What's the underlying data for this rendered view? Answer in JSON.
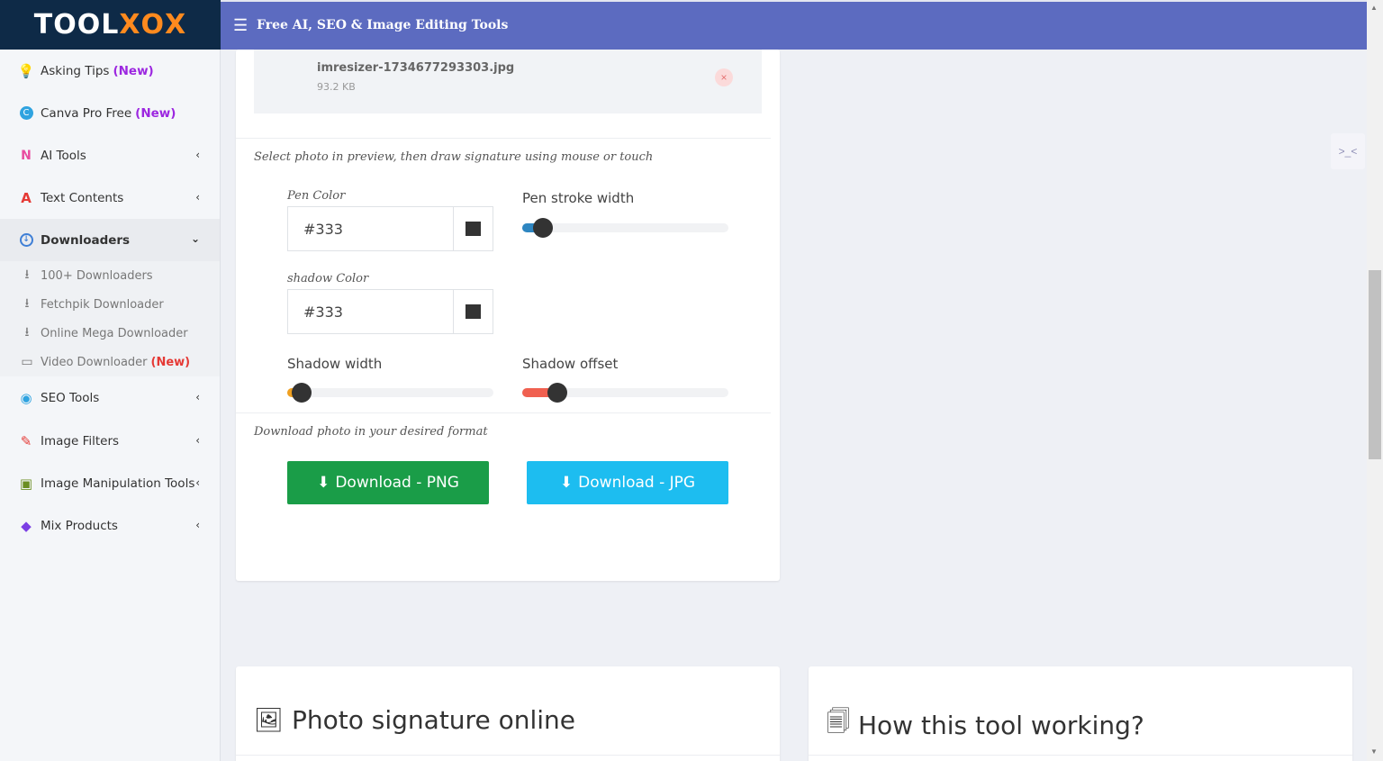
{
  "header": {
    "logo_part1": "TOOL",
    "logo_part2": "X",
    "logo_part3": "O",
    "logo_part4": "X",
    "title": "Free AI, SEO & Image Editing Tools",
    "menu_icon": "hamburger-icon"
  },
  "sidebar": {
    "items": [
      {
        "label": "Asking Tips",
        "badge": "(New)",
        "icon": "lightbulb-icon"
      },
      {
        "label": "Canva Pro Free",
        "badge": "(New)",
        "icon": "canva-icon"
      },
      {
        "label": "AI Tools",
        "icon": "ai-icon"
      },
      {
        "label": "Text Contents",
        "icon": "text-icon"
      },
      {
        "label": "Downloaders",
        "icon": "download-circle-icon"
      },
      {
        "label": "SEO Tools",
        "icon": "seo-icon"
      },
      {
        "label": "Image Filters",
        "icon": "brush-icon"
      },
      {
        "label": "Image Manipulation Tools",
        "icon": "image-icon"
      },
      {
        "label": "Mix Products",
        "icon": "layers-icon"
      }
    ],
    "sub_items": [
      {
        "label": "100+ Downloaders"
      },
      {
        "label": "Fetchpik Downloader"
      },
      {
        "label": "Online Mega Downloader"
      },
      {
        "label": "Video Downloader",
        "badge": "(New)"
      }
    ]
  },
  "file": {
    "name": "imresizer-1734677293303.jpg",
    "size": "93.2 KB",
    "remove_symbol": "×"
  },
  "editor": {
    "hint": "Select photo in preview, then draw signature using mouse or touch",
    "pen_color_label": "Pen Color",
    "pen_color_value": "#333",
    "pen_stroke_label": "Pen stroke width",
    "pen_stroke_level": 0.1,
    "shadow_color_label": "shadow Color",
    "shadow_color_value": "#333",
    "shadow_width_label": "Shadow width",
    "shadow_width_level": 0.07,
    "shadow_offset_label": "Shadow offset",
    "shadow_offset_level": 0.17,
    "download_hint": "Download photo in your desired format",
    "download_png": "Download - PNG",
    "download_jpg": "Download - JPG"
  },
  "sections": {
    "left_title": "Photo signature online",
    "right_title": "How this tool working?"
  },
  "colors": {
    "header_bg": "#5c6bc0",
    "logo_bg": "#0e2a47",
    "logo_accent": "#ff8a1e",
    "png_button": "#1a9d48",
    "jpg_button": "#1dbdf0",
    "pen_slider_fill": "#2e86c1",
    "shadow_width_fill": "#f0a020",
    "shadow_offset_fill": "#f06050",
    "new_badge": "#9c27e0",
    "new_badge_red": "#e53935"
  }
}
